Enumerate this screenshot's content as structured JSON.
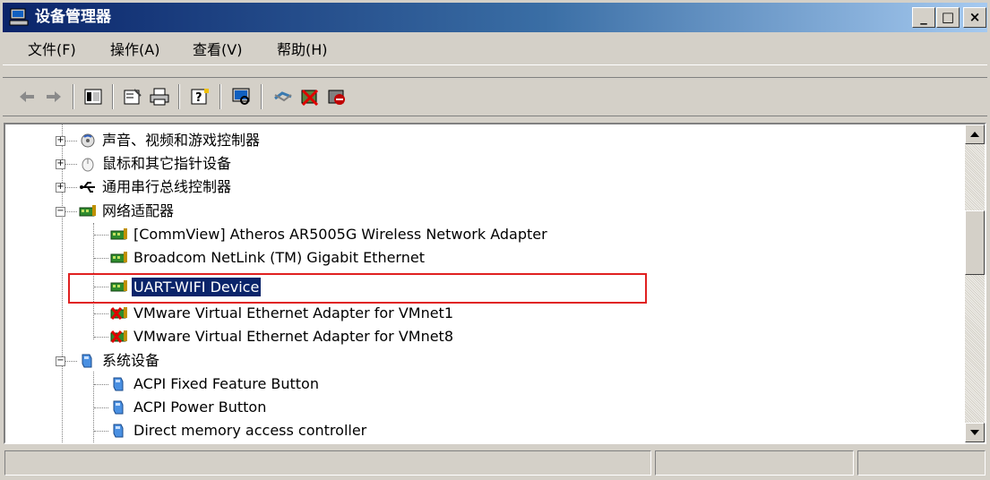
{
  "window": {
    "title": "设备管理器",
    "controls": {
      "minimize": "_",
      "maximize": "□",
      "close": "×"
    }
  },
  "menu": [
    {
      "label": "文件(F)"
    },
    {
      "label": "操作(A)"
    },
    {
      "label": "查看(V)"
    },
    {
      "label": "帮助(H)"
    }
  ],
  "toolbar": {
    "buttons": [
      "back-icon",
      "forward-icon",
      "show-hide-console-tree-icon",
      "properties-icon",
      "print-icon",
      "help-icon",
      "scan-hardware-icon",
      "update-driver-icon",
      "uninstall-icon",
      "disable-icon"
    ]
  },
  "tree": {
    "nodes": [
      {
        "label": "声音、视频和游戏控制器",
        "icon": "sound-icon",
        "expander": "+"
      },
      {
        "label": "鼠标和其它指针设备",
        "icon": "mouse-icon",
        "expander": "+"
      },
      {
        "label": "通用串行总线控制器",
        "icon": "usb-icon",
        "expander": "+"
      },
      {
        "label": "网络适配器",
        "icon": "network-adapter-icon",
        "expander": "−"
      },
      {
        "label": "[CommView] Atheros AR5005G Wireless Network Adapter",
        "icon": "network-adapter-icon"
      },
      {
        "label": "Broadcom NetLink (TM) Gigabit Ethernet",
        "icon": "network-adapter-icon"
      },
      {
        "label": "UART-WIFI Device",
        "icon": "network-adapter-icon",
        "selected": true
      },
      {
        "label": "VMware Virtual Ethernet Adapter for VMnet1",
        "icon": "network-adapter-disabled-icon"
      },
      {
        "label": "VMware Virtual Ethernet Adapter for VMnet8",
        "icon": "network-adapter-disabled-icon"
      },
      {
        "label": "系统设备",
        "icon": "system-device-icon",
        "expander": "−"
      },
      {
        "label": "ACPI Fixed Feature Button",
        "icon": "system-device-icon"
      },
      {
        "label": "ACPI Power Button",
        "icon": "system-device-icon"
      },
      {
        "label": "Direct memory access controller",
        "icon": "system-device-icon"
      }
    ]
  },
  "colors": {
    "selection": "#0a246a",
    "highlight_box": "#e02020",
    "titlebar_start": "#0a246a",
    "titlebar_end": "#a6caf0"
  }
}
